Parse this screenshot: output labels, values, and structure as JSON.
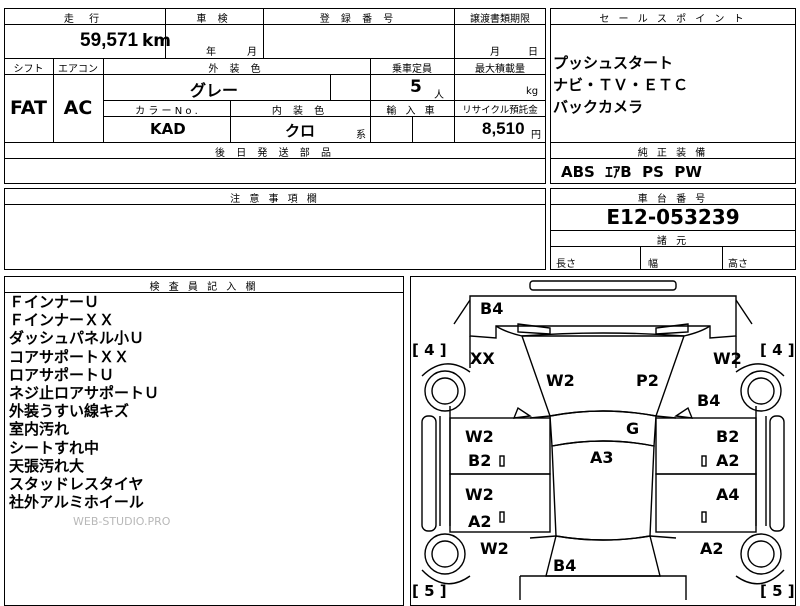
{
  "top": {
    "mileage_label": "走 行",
    "mileage_value": "59,571",
    "mileage_unit": "km",
    "inspection_label": "車 検",
    "inspection_year": "年",
    "inspection_month": "月",
    "reg_label": "登 録 番 号",
    "transfer_label": "譲渡書類期限",
    "transfer_month": "月",
    "transfer_day": "日",
    "shift_label": "シフト",
    "shift_value": "FAT",
    "aircon_label": "エアコン",
    "aircon_value": "AC",
    "color_label": "外 装 色",
    "color_value": "グレー",
    "capacity_label": "乗車定員",
    "capacity_value": "5",
    "capacity_unit": "人",
    "load_label": "最大積載量",
    "load_unit": "kg",
    "colorno_label": "カ ラ ー  N o .",
    "colorno_value": "KAD",
    "interior_label": "内 装 色",
    "interior_value": "クロ",
    "interior_unit": "系",
    "import_label": "輸 入 車",
    "recycle_label": "リサイクル預託金",
    "recycle_value": "8,510",
    "recycle_unit": "円",
    "later_parts_label": "後 日 発 送 部 品"
  },
  "sales": {
    "label": "セ ー ル ス ポ イ ン ト",
    "lines": [
      "プッシュスタート",
      "ナビ・ＴＶ・ＥＴＣ",
      "バックカメラ"
    ]
  },
  "equipment": {
    "label": "純 正 装 備",
    "value": "ABS  ｴｱB  PS  PW"
  },
  "notes": {
    "label": "注 意 事 項 欄"
  },
  "chassis": {
    "label": "車 台 番 号",
    "value": "E12-053239",
    "dims_label": "諸 元",
    "length_label": "長さ",
    "width_label": "幅",
    "height_label": "高さ"
  },
  "inspector": {
    "label": "検 査 員 記 入 欄",
    "lines": [
      "ＦインナーＵ",
      "ＦインナーＸＸ",
      "ダッシュパネル小Ｕ",
      "コアサポートＸＸ",
      "ロアサポートＵ",
      "ネジ止ロアサポートＵ",
      "外装うすい線キズ",
      "室内汚れ",
      "シートすれ中",
      "天張汚れ大",
      "スタッドレスタイヤ",
      "社外アルミホイール"
    ],
    "watermark": "WEB-STUDIO.PRO"
  },
  "diagram": {
    "marks": {
      "b4_top": "B4",
      "xx": "XX",
      "w2_right_top": "W2",
      "w2_hood": "W2",
      "p2": "P2",
      "b4_right": "B4",
      "g": "G",
      "a3": "A3",
      "w2_lf": "W2",
      "b2_lf": "B2",
      "b2_rf": "B2",
      "a2_rf": "A2",
      "w2_lr": "W2",
      "a2_lr": "A2",
      "a4": "A4",
      "w2_bottom": "W2",
      "a2_bottom": "A2",
      "b4_bottom": "B4"
    },
    "tire_left_top": "[ 4 ]",
    "tire_right_top": "[ 4 ]",
    "tire_left_bottom": "[ 5 ]",
    "tire_right_bottom": "[ 5 ]"
  }
}
